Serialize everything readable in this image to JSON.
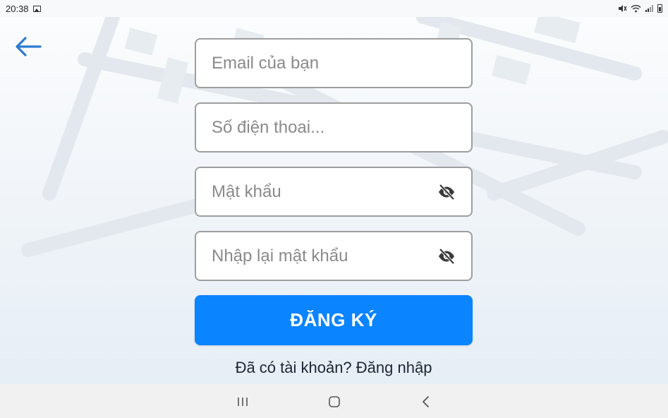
{
  "status_bar": {
    "time": "20:38",
    "icons": [
      "image-icon",
      "mute-icon",
      "wifi-icon",
      "signal-icon",
      "battery-icon"
    ]
  },
  "header": {
    "back_icon": "arrow-left-icon",
    "accent_color": "#2b7bd1"
  },
  "form": {
    "email": {
      "placeholder": "Email của bạn",
      "value": ""
    },
    "phone": {
      "placeholder": "Số điện thoai...",
      "value": ""
    },
    "password": {
      "placeholder": "Mật khẩu",
      "value": "",
      "toggle_icon": "eye-off-icon"
    },
    "confirm_password": {
      "placeholder": "Nhập lại mật khẩu",
      "value": "",
      "toggle_icon": "eye-off-icon"
    },
    "register_label": "ĐĂNG KÝ",
    "register_color": "#0a84ff",
    "login_prompt": "Đã có tài khoản? Đăng nhập"
  },
  "nav_bar": {
    "icons": [
      "recent-apps-icon",
      "home-icon",
      "back-nav-icon"
    ]
  }
}
